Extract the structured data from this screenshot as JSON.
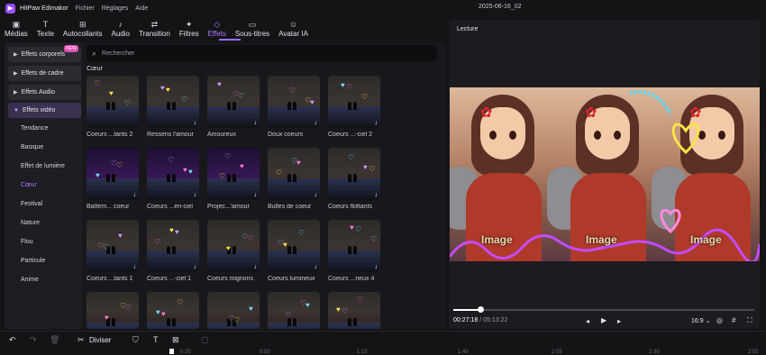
{
  "titlebar": {
    "app_name": "HitPaw Edimakor",
    "menus": [
      "Fichier",
      "Réglages",
      "Aide"
    ],
    "project_title": "2025-06-16_02"
  },
  "tabs": [
    {
      "label": "Médias",
      "icon": "media-icon"
    },
    {
      "label": "Texte",
      "icon": "text-icon"
    },
    {
      "label": "Autocollants",
      "icon": "sticker-icon"
    },
    {
      "label": "Audio",
      "icon": "music-icon"
    },
    {
      "label": "Transition",
      "icon": "transition-icon"
    },
    {
      "label": "Filtres",
      "icon": "filter-icon"
    },
    {
      "label": "Effets",
      "icon": "effects-icon",
      "active": true
    },
    {
      "label": "Sous-titres",
      "icon": "subtitle-icon"
    },
    {
      "label": "Avatar IA",
      "icon": "avatar-icon"
    }
  ],
  "sidebar": {
    "categories": [
      "Effets corporels",
      "Effets de cadre",
      "Effets Audio",
      "Effets vidéo"
    ],
    "new_badge": "NEW",
    "subcategories": [
      "Tendance",
      "Basique",
      "Effet de lumière",
      "Cœur",
      "Festival",
      "Nature",
      "Flou",
      "Particule",
      "Anime"
    ],
    "active_sub": "Cœur"
  },
  "search": {
    "placeholder": "Rechercher"
  },
  "section_label": "Cœur",
  "effects": [
    "Coeurs ...tants 2",
    "Ressens l'amour",
    "Amoureux",
    "Doux coeurs",
    "Coeurs ...-ciel 2",
    "Battem... coeur",
    "Coeurs ...en-ciel",
    "Projec...'amour",
    "Bulles de coeur",
    "Coeurs flottants",
    "Coeurs ...tants 1",
    "Coeurs ...-ciel 1",
    "Coeurs mignons",
    "Coeurs lumineux",
    "Coeurs ...neux 4"
  ],
  "preview": {
    "title": "Lecture",
    "image_word": "Image"
  },
  "playback": {
    "current": "00:27:18",
    "separator": " / ",
    "total": "05:13:22",
    "aspect_ratio": "16:9",
    "progress_fraction": 0.09
  },
  "timeline": {
    "split_label": "Diviser",
    "ruler_ticks": [
      "0:25",
      "0:50",
      "1:15",
      "1:40",
      "2:05",
      "2:30",
      "2:55"
    ]
  },
  "colors": {
    "accent": "#9c6cff",
    "background": "#141417"
  }
}
